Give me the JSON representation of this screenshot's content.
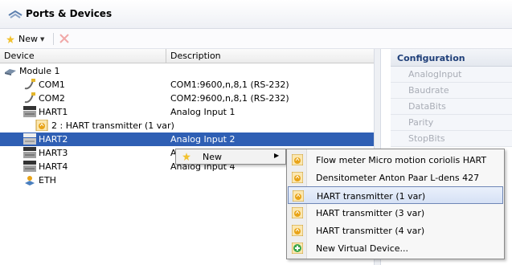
{
  "window": {
    "title": "Ports & Devices"
  },
  "toolbar": {
    "new_label": "New"
  },
  "grid": {
    "columns": {
      "device": "Device",
      "description": "Description"
    },
    "rows": [
      {
        "name": "Module 1",
        "description": ""
      },
      {
        "name": "COM1",
        "description": "COM1:9600,n,8,1 (RS-232)"
      },
      {
        "name": "COM2",
        "description": "COM2:9600,n,8,1 (RS-232)"
      },
      {
        "name": "HART1",
        "description": "Analog Input 1"
      },
      {
        "name": "2 : HART transmitter (1 var)",
        "description": ""
      },
      {
        "name": "HART2",
        "description": "Analog Input 2"
      },
      {
        "name": "HART3",
        "description": "A"
      },
      {
        "name": "HART4",
        "description": "Analog Input 4"
      },
      {
        "name": "ETH",
        "description": ""
      }
    ]
  },
  "configuration": {
    "title": "Configuration",
    "items": [
      "AnalogInput",
      "Baudrate",
      "DataBits",
      "Parity",
      "StopBits"
    ]
  },
  "context_menu": {
    "new_label": "New"
  },
  "submenu": {
    "items": [
      "Flow meter Micro motion coriolis HART",
      "Densitometer Anton Paar L-dens 427",
      "HART transmitter (1 var)",
      "HART transmitter (3 var)",
      "HART transmitter (4 var)",
      "New Virtual Device..."
    ]
  },
  "colors": {
    "selection": "#2f5fb4",
    "config_title": "#1f3f79",
    "icon_orange": "#e8a317"
  }
}
